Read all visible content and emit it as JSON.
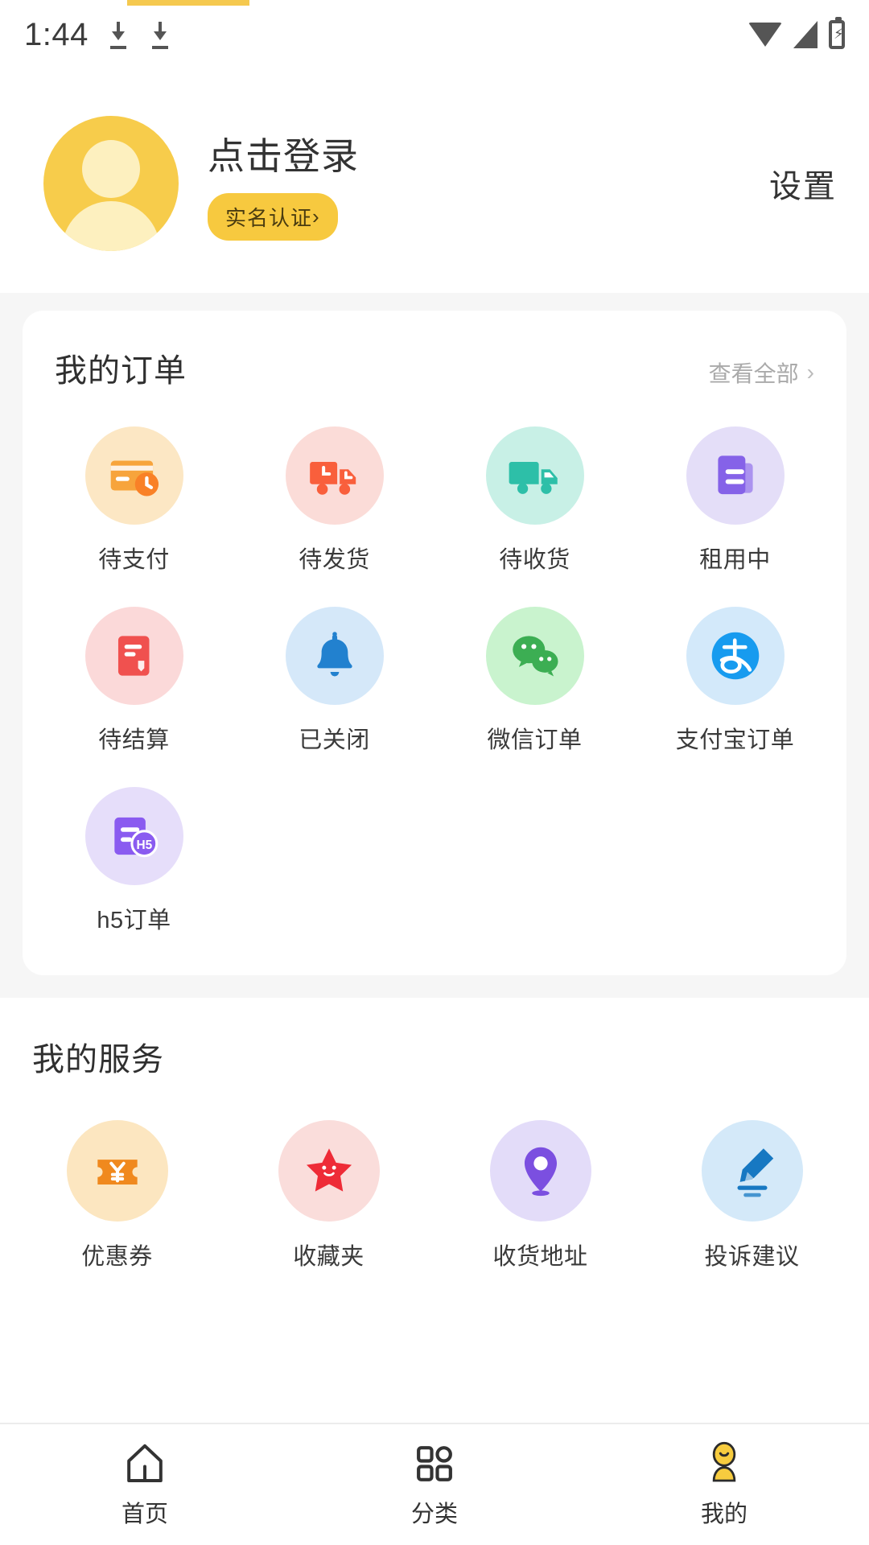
{
  "statusbar": {
    "time": "1:44",
    "icons": [
      "download-icon",
      "download-icon",
      "wifi-icon",
      "signal-icon",
      "battery-charging-icon"
    ]
  },
  "profile": {
    "avatar_name": "user-avatar-placeholder",
    "login_text": "点击登录",
    "verify_badge": "实名认证",
    "verify_chevron": "›",
    "settings_label": "设置"
  },
  "orders": {
    "title": "我的订单",
    "view_all": "查看全部",
    "view_all_chevron": "›",
    "items": [
      {
        "label": "待支付",
        "icon": "credit-card-clock-icon",
        "bubble": "#FCE7C4",
        "fg": "#F7A43C",
        "fg2": "#F98127"
      },
      {
        "label": "待发货",
        "icon": "truck-clock-icon",
        "bubble": "#FBDCD8",
        "fg": "#F95F3C",
        "fg2": "#F95F3C"
      },
      {
        "label": "待收货",
        "icon": "truck-icon",
        "bubble": "#C8F0E6",
        "fg": "#2DBFA8",
        "fg2": "#2DBFA8"
      },
      {
        "label": "租用中",
        "icon": "document-lines-icon",
        "bubble": "#E4DEF8",
        "fg": "#8562E8",
        "fg2": "#AB93EF"
      },
      {
        "label": "待结算",
        "icon": "invoice-icon",
        "bubble": "#FBD9D9",
        "fg": "#F0514F",
        "fg2": "#F0514F"
      },
      {
        "label": "已关闭",
        "icon": "bell-icon",
        "bubble": "#D5E8F9",
        "fg": "#2281CF",
        "fg2": "#2281CF"
      },
      {
        "label": "微信订单",
        "icon": "wechat-icon",
        "bubble": "#C9F3CE",
        "fg": "#3CAE53",
        "fg2": "#3CAE53"
      },
      {
        "label": "支付宝订单",
        "icon": "alipay-icon",
        "bubble": "#D3E9FA",
        "fg": "#179BEF",
        "fg2": "#ffffff"
      },
      {
        "label": "h5订单",
        "icon": "h5-document-icon",
        "bubble": "#E6DEFA",
        "fg": "#8A5BF0",
        "fg2": "#8A5BF0"
      }
    ]
  },
  "services": {
    "title": "我的服务",
    "items": [
      {
        "label": "优惠券",
        "icon": "coupon-yen-icon",
        "bubble": "#FCE6C0",
        "fg": "#F0891E"
      },
      {
        "label": "收藏夹",
        "icon": "star-face-icon",
        "bubble": "#FADDDB",
        "fg": "#EE2B37"
      },
      {
        "label": "收货地址",
        "icon": "location-pin-icon",
        "bubble": "#E3DCF9",
        "fg": "#7B4FE0"
      },
      {
        "label": "投诉建议",
        "icon": "pen-edit-icon",
        "bubble": "#D4E9F9",
        "fg": "#1778C2"
      }
    ]
  },
  "tabbar": {
    "tabs": [
      {
        "label": "首页",
        "icon": "home-icon",
        "active": false
      },
      {
        "label": "分类",
        "icon": "grid-icon",
        "active": false
      },
      {
        "label": "我的",
        "icon": "person-icon",
        "active": true
      }
    ],
    "active_color": "#F7CC3F",
    "inactive_color": "#333333"
  }
}
